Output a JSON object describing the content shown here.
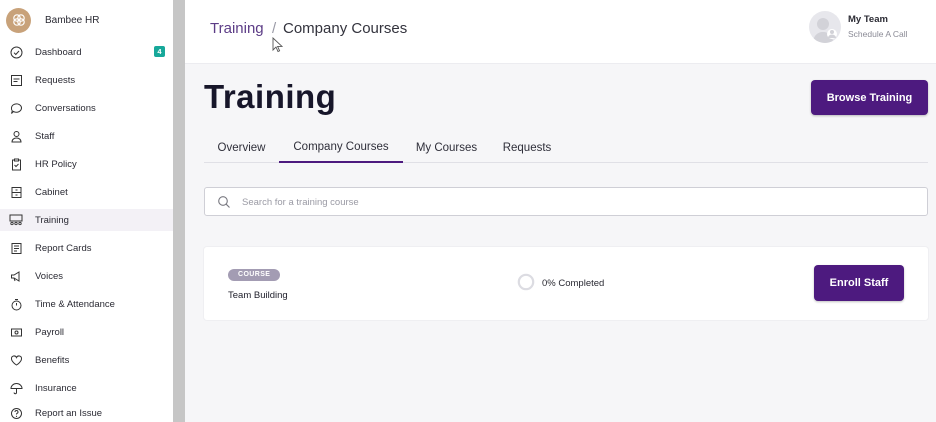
{
  "brand": {
    "name": "Bambee HR",
    "color": "#c8a27a"
  },
  "sidebar": {
    "items": [
      {
        "label": "Dashboard",
        "icon": "check-circle-icon",
        "badge": "4"
      },
      {
        "label": "Requests",
        "icon": "requests-icon"
      },
      {
        "label": "Conversations",
        "icon": "chat-bubble-icon"
      },
      {
        "label": "Staff",
        "icon": "person-icon"
      },
      {
        "label": "HR Policy",
        "icon": "clipboard-icon"
      },
      {
        "label": "Cabinet",
        "icon": "cabinet-icon"
      },
      {
        "label": "Training",
        "icon": "training-icon",
        "active": true
      },
      {
        "label": "Report Cards",
        "icon": "report-card-icon"
      },
      {
        "label": "Voices",
        "icon": "megaphone-icon"
      },
      {
        "label": "Time & Attendance",
        "icon": "stopwatch-icon"
      },
      {
        "label": "Payroll",
        "icon": "payroll-icon"
      },
      {
        "label": "Benefits",
        "icon": "heart-icon"
      },
      {
        "label": "Insurance",
        "icon": "umbrella-icon"
      },
      {
        "label": "Report an Issue",
        "icon": "help-icon"
      }
    ]
  },
  "header": {
    "breadcrumb": {
      "parent": "Training",
      "separator": "/",
      "current": "Company Courses"
    },
    "user": {
      "name": "My Team",
      "action": "Schedule A Call"
    }
  },
  "main": {
    "title": "Training",
    "browse_button": "Browse Training",
    "tabs": [
      {
        "label": "Overview"
      },
      {
        "label": "Company Courses",
        "active": true
      },
      {
        "label": "My Courses"
      },
      {
        "label": "Requests"
      }
    ],
    "search": {
      "placeholder": "Search for a training course",
      "value": ""
    },
    "courses": [
      {
        "badge": "COURSE",
        "name": "Team Building",
        "progress_percent": 0,
        "progress_label": "0% Completed",
        "action": "Enroll Staff"
      }
    ]
  },
  "colors": {
    "accent": "#4d1a7f",
    "badge": "#17a89a",
    "breadcrumb": "#5c3c86"
  }
}
